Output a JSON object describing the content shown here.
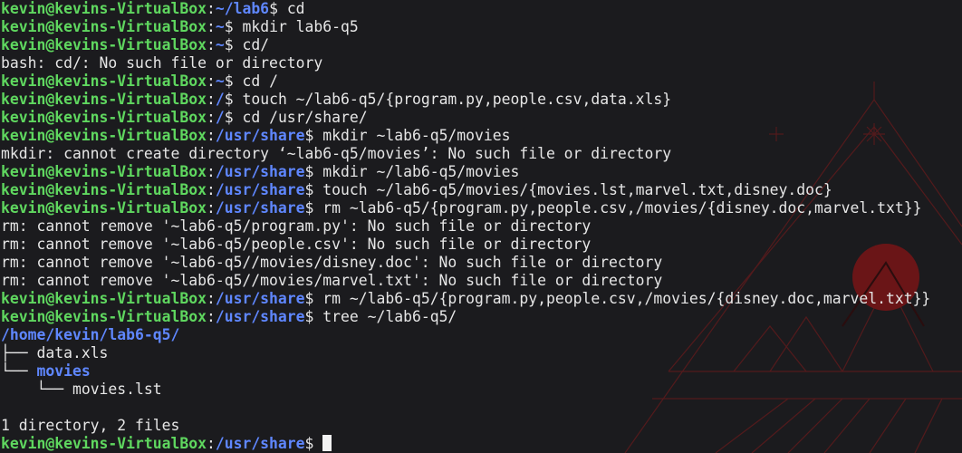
{
  "theme": {
    "background": "#1b1b1e",
    "user_color": "#5fd75f",
    "path_color": "#5f87ff",
    "text_color": "#e6e6e6",
    "wallpaper_accent": "#9b1c1c"
  },
  "terminal": {
    "lines": [
      {
        "type": "prompt",
        "user": "kevin@kevins-VirtualBox",
        "path": "~/lab6",
        "symbol": "$",
        "command": "cd"
      },
      {
        "type": "prompt",
        "user": "kevin@kevins-VirtualBox",
        "path": "~",
        "symbol": "$",
        "command": "mkdir lab6-q5"
      },
      {
        "type": "prompt",
        "user": "kevin@kevins-VirtualBox",
        "path": "~",
        "symbol": "$",
        "command": "cd/"
      },
      {
        "type": "output",
        "text": "bash: cd/: No such file or directory"
      },
      {
        "type": "prompt",
        "user": "kevin@kevins-VirtualBox",
        "path": "~",
        "symbol": "$",
        "command": "cd /"
      },
      {
        "type": "prompt",
        "user": "kevin@kevins-VirtualBox",
        "path": "/",
        "symbol": "$",
        "command": "touch ~/lab6-q5/{program.py,people.csv,data.xls}"
      },
      {
        "type": "prompt",
        "user": "kevin@kevins-VirtualBox",
        "path": "/",
        "symbol": "$",
        "command": "cd /usr/share/"
      },
      {
        "type": "prompt",
        "user": "kevin@kevins-VirtualBox",
        "path": "/usr/share",
        "symbol": "$",
        "command": "mkdir ~lab6-q5/movies"
      },
      {
        "type": "output",
        "text": "mkdir: cannot create directory ‘~lab6-q5/movies’: No such file or directory"
      },
      {
        "type": "prompt",
        "user": "kevin@kevins-VirtualBox",
        "path": "/usr/share",
        "symbol": "$",
        "command": "mkdir ~/lab6-q5/movies"
      },
      {
        "type": "prompt",
        "user": "kevin@kevins-VirtualBox",
        "path": "/usr/share",
        "symbol": "$",
        "command": "touch ~/lab6-q5/movies/{movies.lst,marvel.txt,disney.doc}"
      },
      {
        "type": "prompt",
        "user": "kevin@kevins-VirtualBox",
        "path": "/usr/share",
        "symbol": "$",
        "command": "rm ~lab6-q5/{program.py,people.csv,/movies/{disney.doc,marvel.txt}}"
      },
      {
        "type": "output",
        "text": "rm: cannot remove '~lab6-q5/program.py': No such file or directory"
      },
      {
        "type": "output",
        "text": "rm: cannot remove '~lab6-q5/people.csv': No such file or directory"
      },
      {
        "type": "output",
        "text": "rm: cannot remove '~lab6-q5//movies/disney.doc': No such file or directory"
      },
      {
        "type": "output",
        "text": "rm: cannot remove '~lab6-q5//movies/marvel.txt': No such file or directory"
      },
      {
        "type": "prompt",
        "user": "kevin@kevins-VirtualBox",
        "path": "/usr/share",
        "symbol": "$",
        "command": "rm ~/lab6-q5/{program.py,people.csv,/movies/{disney.doc,marvel.txt}}"
      },
      {
        "type": "prompt",
        "user": "kevin@kevins-VirtualBox",
        "path": "/usr/share",
        "symbol": "$",
        "command": "tree ~/lab6-q5/"
      },
      {
        "type": "tree_root",
        "text": "/home/kevin/lab6-q5/"
      },
      {
        "type": "tree",
        "prefix": "├── ",
        "text": "data.xls",
        "is_dir": false
      },
      {
        "type": "tree",
        "prefix": "└── ",
        "text": "movies",
        "is_dir": true
      },
      {
        "type": "tree",
        "prefix": "    └── ",
        "text": "movies.lst",
        "is_dir": false
      },
      {
        "type": "blank"
      },
      {
        "type": "output",
        "text": "1 directory, 2 files"
      },
      {
        "type": "prompt",
        "user": "kevin@kevins-VirtualBox",
        "path": "/usr/share",
        "symbol": "$",
        "command": "",
        "cursor": true
      }
    ]
  }
}
